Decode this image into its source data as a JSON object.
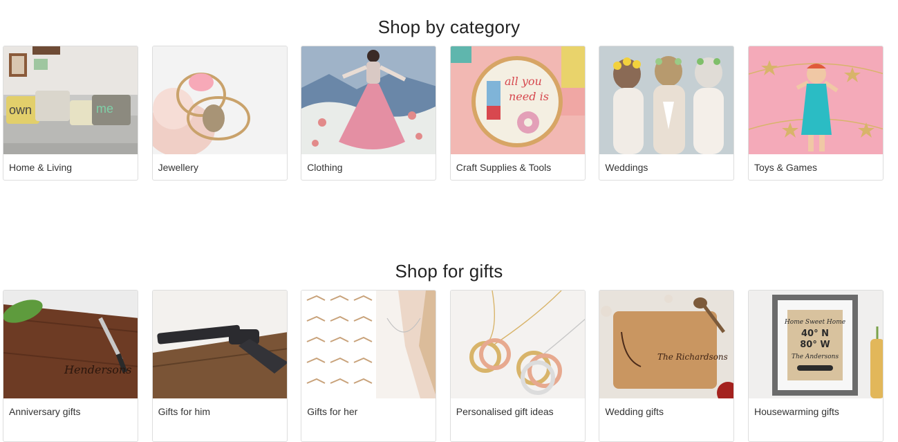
{
  "sections": [
    {
      "title": "Shop by category",
      "items": [
        {
          "label": "Home & Living"
        },
        {
          "label": "Jewellery"
        },
        {
          "label": "Clothing"
        },
        {
          "label": "Craft Supplies & Tools"
        },
        {
          "label": "Weddings"
        },
        {
          "label": "Toys & Games"
        }
      ]
    },
    {
      "title": "Shop for gifts",
      "items": [
        {
          "label": "Anniversary gifts"
        },
        {
          "label": "Gifts for him"
        },
        {
          "label": "Gifts for her"
        },
        {
          "label": "Personalised gift ideas"
        },
        {
          "label": "Wedding gifts"
        },
        {
          "label": "Housewarming gifts"
        }
      ]
    }
  ]
}
